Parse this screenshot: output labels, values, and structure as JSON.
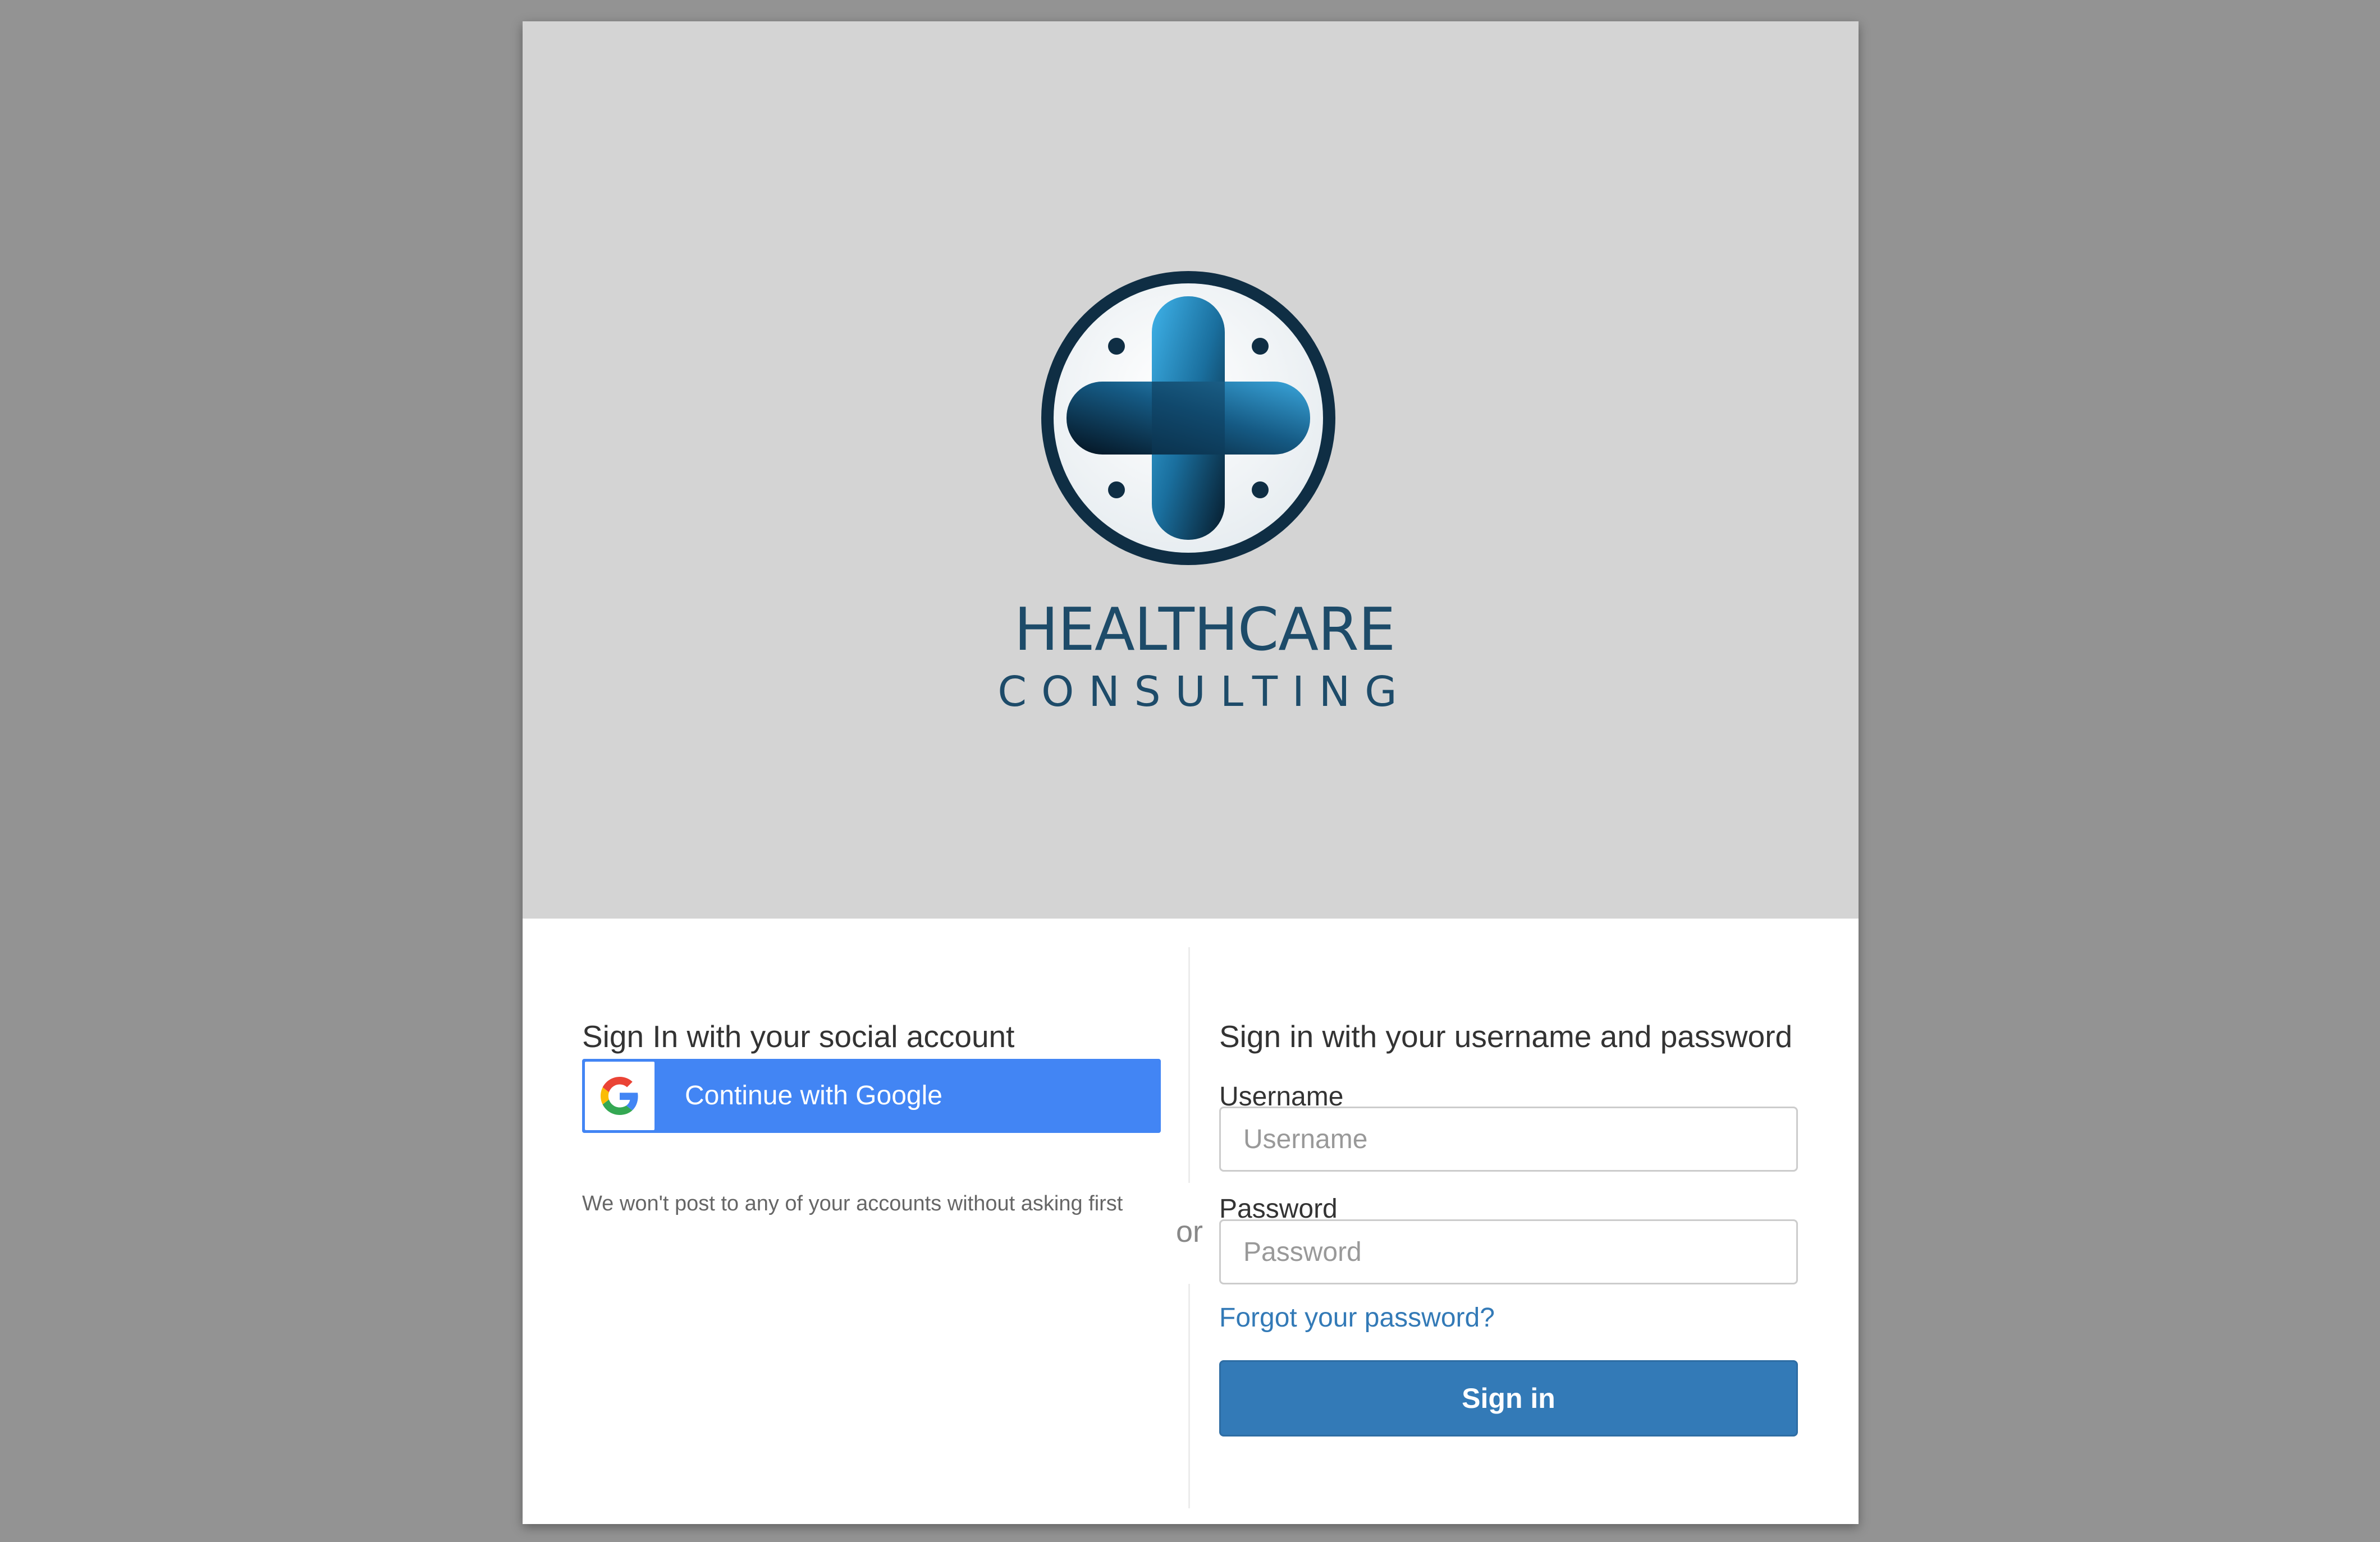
{
  "logo": {
    "line1": "HEALTHCARE",
    "line2": "CONSULTING",
    "colors": {
      "ring": "#0f2e44",
      "cross_light": "#2c9fd6",
      "cross_dark": "#0a2236",
      "text": "#1d4b69"
    }
  },
  "social": {
    "title": "Sign In with your social account",
    "google_button_label": "Continue with Google",
    "google_icon": "google-g-icon",
    "note": "We won't post to any of your accounts without asking first"
  },
  "separator": {
    "text": "or"
  },
  "credentials": {
    "title": "Sign in with your username and password",
    "username_label": "Username",
    "username_placeholder": "Username",
    "username_value": "",
    "password_label": "Password",
    "password_placeholder": "Password",
    "password_value": "",
    "forgot_link": "Forgot your password?",
    "signin_button": "Sign in"
  },
  "colors": {
    "page_background": "#939393",
    "banner_background": "#d4d4d4",
    "google_blue": "#4285f4",
    "primary_blue": "#337ab7",
    "link_blue": "#337ab7"
  }
}
